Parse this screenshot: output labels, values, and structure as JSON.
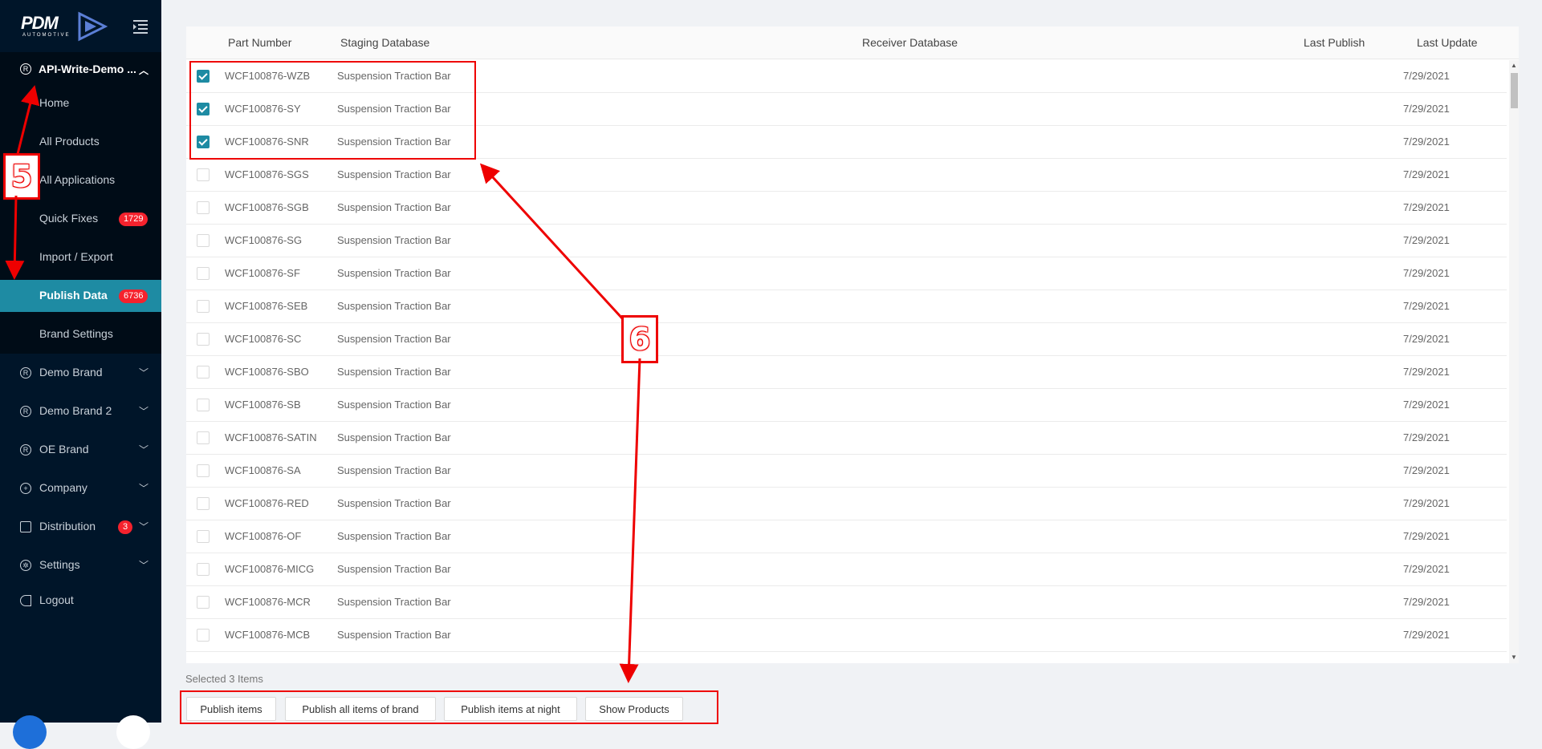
{
  "sidebar": {
    "logo_text": "PDM",
    "logo_sub": "AUTOMOTIVE",
    "brand_header": "API-Write-Demo ...",
    "sub_items": [
      {
        "label": "Home"
      },
      {
        "label": "All Products"
      },
      {
        "label": "All Applications"
      },
      {
        "label": "Quick Fixes",
        "badge": "1729"
      },
      {
        "label": "Import / Export"
      },
      {
        "label": "Publish Data",
        "badge": "6736",
        "active": true
      },
      {
        "label": "Brand Settings"
      }
    ],
    "menu_items": [
      {
        "label": "Demo Brand",
        "icon": "registered-icon"
      },
      {
        "label": "Demo Brand 2",
        "icon": "registered-icon"
      },
      {
        "label": "OE Brand",
        "icon": "registered-icon"
      },
      {
        "label": "Company",
        "icon": "globe-icon"
      },
      {
        "label": "Distribution",
        "icon": "box-icon",
        "badge": "3"
      },
      {
        "label": "Settings",
        "icon": "gear-icon"
      },
      {
        "label": "Logout",
        "icon": "logout-icon"
      }
    ]
  },
  "table": {
    "headers": {
      "part_number": "Part Number",
      "staging": "Staging Database",
      "receiver": "Receiver Database",
      "last_publish": "Last Publish",
      "last_update": "Last Update"
    },
    "rows": [
      {
        "part": "WCF100876-WZB",
        "staging": "Suspension Traction Bar",
        "last_update": "7/29/2021",
        "checked": true
      },
      {
        "part": "WCF100876-SY",
        "staging": "Suspension Traction Bar",
        "last_update": "7/29/2021",
        "checked": true
      },
      {
        "part": "WCF100876-SNR",
        "staging": "Suspension Traction Bar",
        "last_update": "7/29/2021",
        "checked": true
      },
      {
        "part": "WCF100876-SGS",
        "staging": "Suspension Traction Bar",
        "last_update": "7/29/2021",
        "checked": false
      },
      {
        "part": "WCF100876-SGB",
        "staging": "Suspension Traction Bar",
        "last_update": "7/29/2021",
        "checked": false
      },
      {
        "part": "WCF100876-SG",
        "staging": "Suspension Traction Bar",
        "last_update": "7/29/2021",
        "checked": false
      },
      {
        "part": "WCF100876-SF",
        "staging": "Suspension Traction Bar",
        "last_update": "7/29/2021",
        "checked": false
      },
      {
        "part": "WCF100876-SEB",
        "staging": "Suspension Traction Bar",
        "last_update": "7/29/2021",
        "checked": false
      },
      {
        "part": "WCF100876-SC",
        "staging": "Suspension Traction Bar",
        "last_update": "7/29/2021",
        "checked": false
      },
      {
        "part": "WCF100876-SBO",
        "staging": "Suspension Traction Bar",
        "last_update": "7/29/2021",
        "checked": false
      },
      {
        "part": "WCF100876-SB",
        "staging": "Suspension Traction Bar",
        "last_update": "7/29/2021",
        "checked": false
      },
      {
        "part": "WCF100876-SATIN",
        "staging": "Suspension Traction Bar",
        "last_update": "7/29/2021",
        "checked": false
      },
      {
        "part": "WCF100876-SA",
        "staging": "Suspension Traction Bar",
        "last_update": "7/29/2021",
        "checked": false
      },
      {
        "part": "WCF100876-RED",
        "staging": "Suspension Traction Bar",
        "last_update": "7/29/2021",
        "checked": false
      },
      {
        "part": "WCF100876-OF",
        "staging": "Suspension Traction Bar",
        "last_update": "7/29/2021",
        "checked": false
      },
      {
        "part": "WCF100876-MICG",
        "staging": "Suspension Traction Bar",
        "last_update": "7/29/2021",
        "checked": false
      },
      {
        "part": "WCF100876-MCR",
        "staging": "Suspension Traction Bar",
        "last_update": "7/29/2021",
        "checked": false
      },
      {
        "part": "WCF100876-MCB",
        "staging": "Suspension Traction Bar",
        "last_update": "7/29/2021",
        "checked": false
      }
    ]
  },
  "footer": {
    "selected_text": "Selected 3 Items",
    "buttons": [
      "Publish items",
      "Publish all items of brand",
      "Publish items at night",
      "Show Products"
    ]
  },
  "annotations": {
    "label_5": "5",
    "label_6": "6"
  },
  "colors": {
    "sidebar_bg": "#001529",
    "active_item": "#1e8ba3",
    "badge": "#f5222d",
    "annotation": "#e00000"
  }
}
